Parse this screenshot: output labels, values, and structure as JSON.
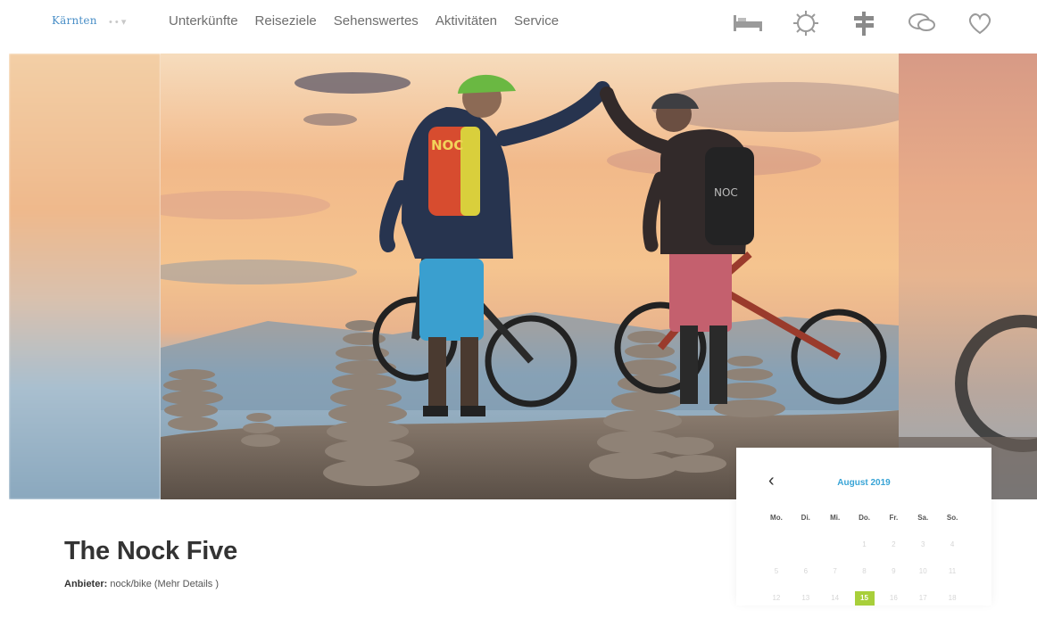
{
  "header": {
    "logo": "Kärnten",
    "lang": "• • ▾",
    "nav": [
      "Unterkünfte",
      "Reiseziele",
      "Sehenswertes",
      "Aktivitäten",
      "Service"
    ],
    "icons": [
      "bed-icon",
      "sun-icon",
      "signpost-icon",
      "chat-icon",
      "heart-icon"
    ]
  },
  "hero": {
    "pack_label": "NOC",
    "pack_label_2": "NOC"
  },
  "product": {
    "title": "The Nock Five",
    "provider_label": "Anbieter:",
    "provider_value": "nock/bike (Mehr Details )"
  },
  "calendar": {
    "prev": "‹",
    "month": "August 2019",
    "weekdays": [
      "Mo.",
      "Di.",
      "Mi.",
      "Do.",
      "Fr.",
      "Sa.",
      "So."
    ],
    "rows": [
      [
        "",
        "",
        "",
        "1",
        "2",
        "3",
        "4"
      ],
      [
        "5",
        "6",
        "7",
        "8",
        "9",
        "10",
        "11"
      ],
      [
        "12",
        "13",
        "14",
        "15",
        "16",
        "17",
        "18"
      ]
    ],
    "selected": "15",
    "accent": "#38a4d6",
    "selected_color": "#a8cf3a"
  }
}
